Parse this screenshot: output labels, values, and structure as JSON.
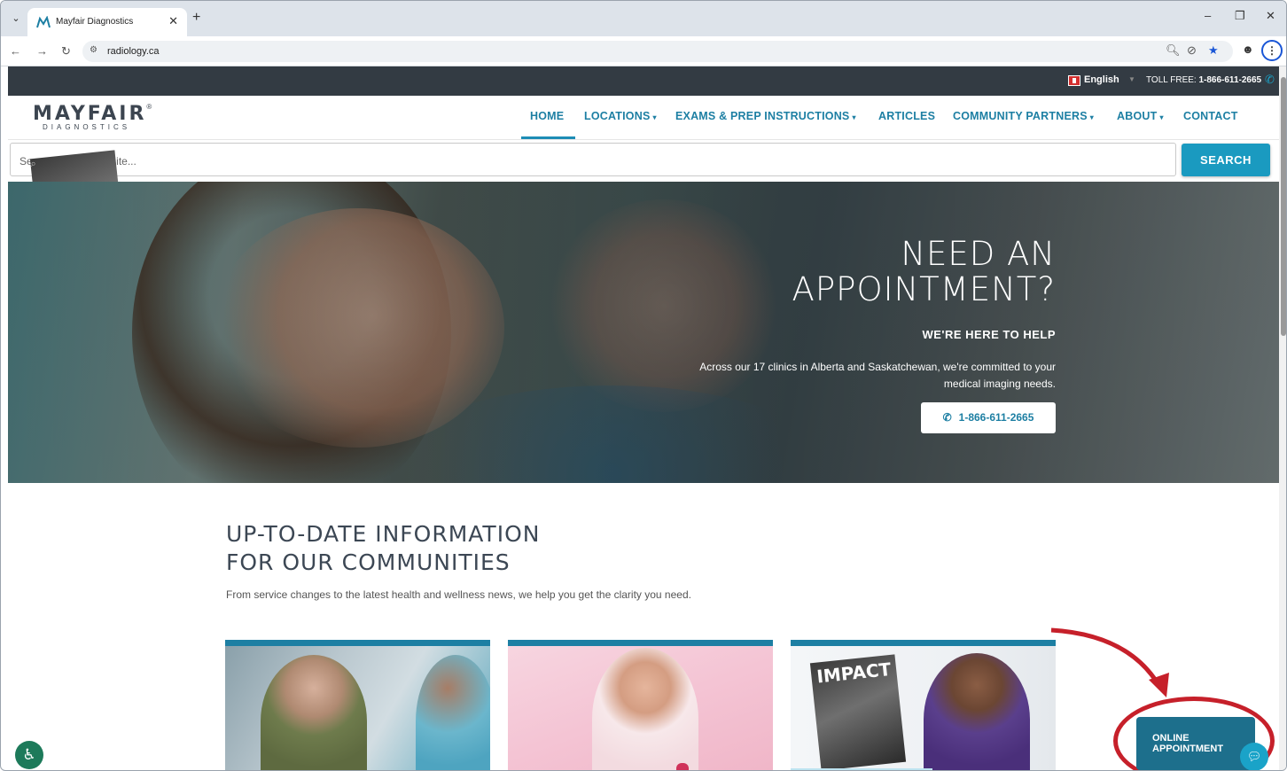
{
  "browser": {
    "tab_title": "Mayfair Diagnostics",
    "url": "radiology.ca"
  },
  "topbar": {
    "language": "English",
    "toll_free_label": "TOLL FREE:",
    "toll_free_number": "1-866-611-2665"
  },
  "logo": {
    "main": "MAYFAIR",
    "reg": "®",
    "sub": "DIAGNOSTICS"
  },
  "nav": {
    "items": [
      {
        "label": "HOME",
        "caret": ""
      },
      {
        "label": "LOCATIONS",
        "caret": "▾"
      },
      {
        "label": "EXAMS & PREP INSTRUCTIONS",
        "caret": "▾"
      },
      {
        "label": "ARTICLES",
        "caret": ""
      },
      {
        "label": "COMMUNITY PARTNERS",
        "caret": "▾"
      },
      {
        "label": "ABOUT",
        "caret": "▾"
      },
      {
        "label": "CONTACT",
        "caret": ""
      }
    ],
    "active": "HOME"
  },
  "search": {
    "placeholder": "Search Whole Website...",
    "button_label": "SEARCH"
  },
  "hero": {
    "title_line1": "NEED AN",
    "title_line2": "APPOINTMENT?",
    "subtitle": "WE'RE HERE TO HELP",
    "text_line1": "Across our 17 clinics in Alberta and Saskatchewan, we're committed to your",
    "text_line2": "medical imaging needs.",
    "phone": "1-866-611-2665"
  },
  "info": {
    "title_line1": "UP-TO-DATE INFORMATION",
    "title_line2": "FOR OUR COMMUNITIES",
    "description": "From service changes to the latest health and wellness news, we help you get the clarity you need."
  },
  "cards": [
    {
      "image": "senior-man-with-nurse"
    },
    {
      "image": "smiling-woman-pink-ribbon"
    },
    {
      "image": "impact-magazine-and-doctor",
      "magazine_title": "IMPACT"
    }
  ],
  "online_appointment": {
    "line1": "ONLINE",
    "line2": "APPOINTMENT"
  },
  "colors": {
    "brand": "#1d7fa3",
    "search_button": "#1a9ac0",
    "topstrip": "#333b43",
    "highlight_annotation": "#c6202a"
  }
}
